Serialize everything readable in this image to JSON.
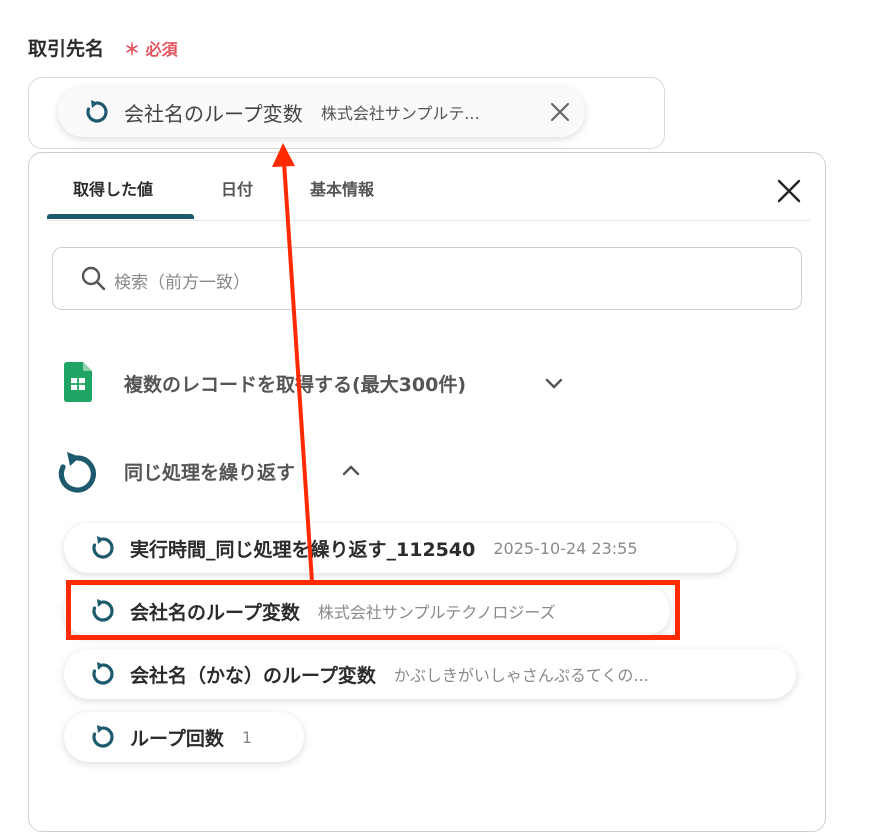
{
  "field": {
    "label": "取引先名",
    "required_mark": "＊",
    "required_text": "必須",
    "selected_name": "会社名のループ変数",
    "selected_value": "株式会社サンプルテ..."
  },
  "tabs": [
    {
      "label": "取得した値",
      "active": true
    },
    {
      "label": "日付",
      "active": false
    },
    {
      "label": "基本情報",
      "active": false
    }
  ],
  "search": {
    "placeholder": "検索（前方一致）"
  },
  "groups": [
    {
      "title": "複数のレコードを取得する(最大300件)",
      "icon": "spreadsheet-icon",
      "expanded": false
    },
    {
      "title": "同じ処理を繰り返す",
      "icon": "loop-icon",
      "expanded": true
    }
  ],
  "items": [
    {
      "name": "実行時間_同じ処理を繰り返す_112540",
      "value": "2025-10-24 23:55"
    },
    {
      "name": "会社名のループ変数",
      "value": "株式会社サンプルテクノロジーズ"
    },
    {
      "name": "会社名（かな）のループ変数",
      "value": "かぶしきがいしゃさんぷるてくの..."
    },
    {
      "name": "ループ回数",
      "value": "1"
    }
  ],
  "colors": {
    "accent": "#1e5a6e",
    "highlight": "#ff2a00",
    "required": "#e8555f",
    "sheets_green": "#1fa463"
  }
}
